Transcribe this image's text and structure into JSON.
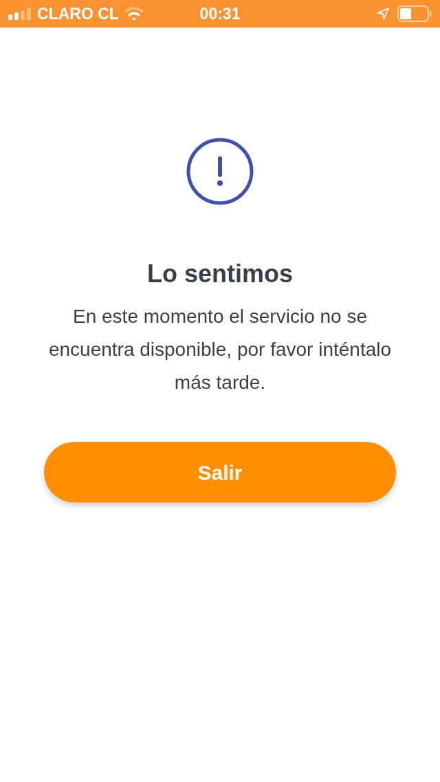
{
  "status_bar": {
    "carrier": "CLARO CL",
    "time": "00:31"
  },
  "message": {
    "title": "Lo sentimos",
    "body": "En este momento el servicio no se encuentra disponible, por favor inténtalo más tarde."
  },
  "button": {
    "label": "Salir"
  }
}
